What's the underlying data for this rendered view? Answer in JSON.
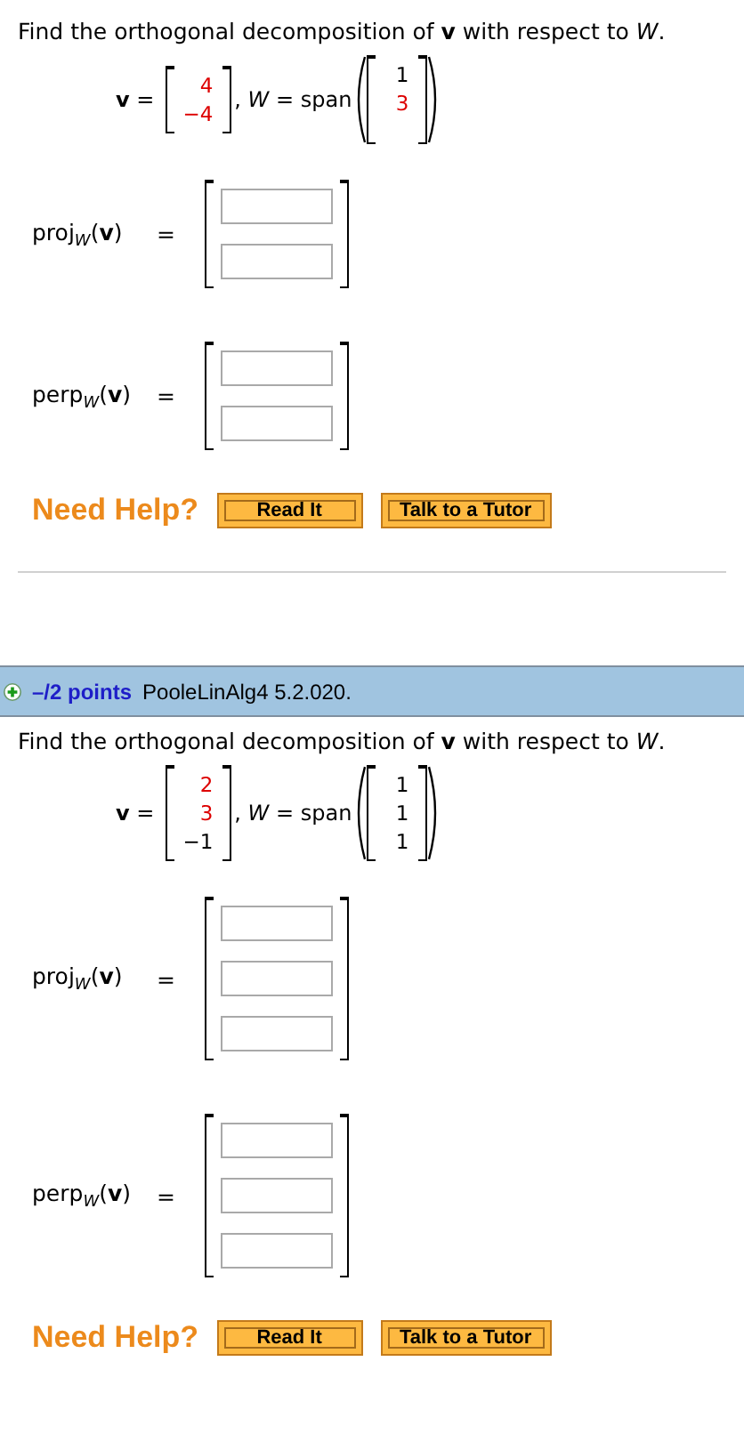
{
  "problems": [
    {
      "prompt": "Find the orthogonal decomposition of **v** with respect to *W*.",
      "v_label": "**v** =",
      "span_label": ", *W* = span",
      "v_entries": [
        {
          "text": "4",
          "color": "#dd0000"
        },
        {
          "text": "−4",
          "color": "#dd0000"
        }
      ],
      "span_entries": [
        {
          "text": "1",
          "color": "#000000"
        },
        {
          "text": "3",
          "color": "#dd0000"
        }
      ],
      "answers": [
        {
          "label": "proj$_{W}$(**v**)",
          "equals": "="
        },
        {
          "label": "perp$_{W}$(**v**)",
          "equals": "="
        }
      ],
      "help": {
        "text": "Need Help?",
        "buttons": [
          "Read It",
          "Talk to a Tutor"
        ]
      }
    },
    {
      "header": {
        "points": "–/2 points",
        "source": "PooleLinAlg4 5.2.020."
      },
      "prompt": "Find the orthogonal decomposition of **v** with respect to *W*.",
      "v_label": "**v** =",
      "span_label": ", *W* = span",
      "v_entries": [
        {
          "text": "2",
          "color": "#dd0000"
        },
        {
          "text": "3",
          "color": "#dd0000"
        },
        {
          "text": "−1",
          "color": "#000000"
        }
      ],
      "span_entries": [
        {
          "text": "1",
          "color": "#000000"
        },
        {
          "text": "1",
          "color": "#000000"
        },
        {
          "text": "1",
          "color": "#000000"
        }
      ],
      "answers": [
        {
          "label": "proj$_{W}$(**v**)",
          "equals": "="
        },
        {
          "label": "perp$_{W}$(**v**)",
          "equals": "="
        }
      ],
      "help": {
        "text": "Need Help?",
        "buttons": [
          "Read It",
          "Talk to a Tutor"
        ]
      }
    }
  ]
}
